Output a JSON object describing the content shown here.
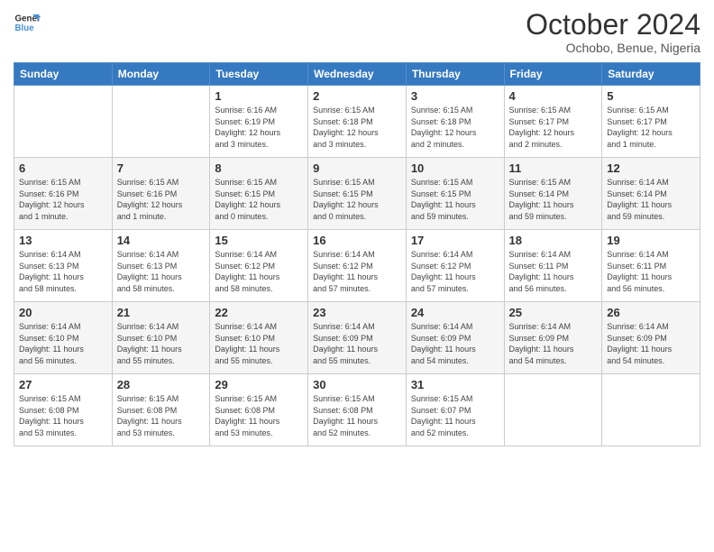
{
  "logo": {
    "line1": "General",
    "line2": "Blue"
  },
  "title": "October 2024",
  "subtitle": "Ochobo, Benue, Nigeria",
  "days_of_week": [
    "Sunday",
    "Monday",
    "Tuesday",
    "Wednesday",
    "Thursday",
    "Friday",
    "Saturday"
  ],
  "weeks": [
    [
      {
        "day": "",
        "info": ""
      },
      {
        "day": "",
        "info": ""
      },
      {
        "day": "1",
        "info": "Sunrise: 6:16 AM\nSunset: 6:19 PM\nDaylight: 12 hours\nand 3 minutes."
      },
      {
        "day": "2",
        "info": "Sunrise: 6:15 AM\nSunset: 6:18 PM\nDaylight: 12 hours\nand 3 minutes."
      },
      {
        "day": "3",
        "info": "Sunrise: 6:15 AM\nSunset: 6:18 PM\nDaylight: 12 hours\nand 2 minutes."
      },
      {
        "day": "4",
        "info": "Sunrise: 6:15 AM\nSunset: 6:17 PM\nDaylight: 12 hours\nand 2 minutes."
      },
      {
        "day": "5",
        "info": "Sunrise: 6:15 AM\nSunset: 6:17 PM\nDaylight: 12 hours\nand 1 minute."
      }
    ],
    [
      {
        "day": "6",
        "info": "Sunrise: 6:15 AM\nSunset: 6:16 PM\nDaylight: 12 hours\nand 1 minute."
      },
      {
        "day": "7",
        "info": "Sunrise: 6:15 AM\nSunset: 6:16 PM\nDaylight: 12 hours\nand 1 minute."
      },
      {
        "day": "8",
        "info": "Sunrise: 6:15 AM\nSunset: 6:15 PM\nDaylight: 12 hours\nand 0 minutes."
      },
      {
        "day": "9",
        "info": "Sunrise: 6:15 AM\nSunset: 6:15 PM\nDaylight: 12 hours\nand 0 minutes."
      },
      {
        "day": "10",
        "info": "Sunrise: 6:15 AM\nSunset: 6:15 PM\nDaylight: 11 hours\nand 59 minutes."
      },
      {
        "day": "11",
        "info": "Sunrise: 6:15 AM\nSunset: 6:14 PM\nDaylight: 11 hours\nand 59 minutes."
      },
      {
        "day": "12",
        "info": "Sunrise: 6:14 AM\nSunset: 6:14 PM\nDaylight: 11 hours\nand 59 minutes."
      }
    ],
    [
      {
        "day": "13",
        "info": "Sunrise: 6:14 AM\nSunset: 6:13 PM\nDaylight: 11 hours\nand 58 minutes."
      },
      {
        "day": "14",
        "info": "Sunrise: 6:14 AM\nSunset: 6:13 PM\nDaylight: 11 hours\nand 58 minutes."
      },
      {
        "day": "15",
        "info": "Sunrise: 6:14 AM\nSunset: 6:12 PM\nDaylight: 11 hours\nand 58 minutes."
      },
      {
        "day": "16",
        "info": "Sunrise: 6:14 AM\nSunset: 6:12 PM\nDaylight: 11 hours\nand 57 minutes."
      },
      {
        "day": "17",
        "info": "Sunrise: 6:14 AM\nSunset: 6:12 PM\nDaylight: 11 hours\nand 57 minutes."
      },
      {
        "day": "18",
        "info": "Sunrise: 6:14 AM\nSunset: 6:11 PM\nDaylight: 11 hours\nand 56 minutes."
      },
      {
        "day": "19",
        "info": "Sunrise: 6:14 AM\nSunset: 6:11 PM\nDaylight: 11 hours\nand 56 minutes."
      }
    ],
    [
      {
        "day": "20",
        "info": "Sunrise: 6:14 AM\nSunset: 6:10 PM\nDaylight: 11 hours\nand 56 minutes."
      },
      {
        "day": "21",
        "info": "Sunrise: 6:14 AM\nSunset: 6:10 PM\nDaylight: 11 hours\nand 55 minutes."
      },
      {
        "day": "22",
        "info": "Sunrise: 6:14 AM\nSunset: 6:10 PM\nDaylight: 11 hours\nand 55 minutes."
      },
      {
        "day": "23",
        "info": "Sunrise: 6:14 AM\nSunset: 6:09 PM\nDaylight: 11 hours\nand 55 minutes."
      },
      {
        "day": "24",
        "info": "Sunrise: 6:14 AM\nSunset: 6:09 PM\nDaylight: 11 hours\nand 54 minutes."
      },
      {
        "day": "25",
        "info": "Sunrise: 6:14 AM\nSunset: 6:09 PM\nDaylight: 11 hours\nand 54 minutes."
      },
      {
        "day": "26",
        "info": "Sunrise: 6:14 AM\nSunset: 6:09 PM\nDaylight: 11 hours\nand 54 minutes."
      }
    ],
    [
      {
        "day": "27",
        "info": "Sunrise: 6:15 AM\nSunset: 6:08 PM\nDaylight: 11 hours\nand 53 minutes."
      },
      {
        "day": "28",
        "info": "Sunrise: 6:15 AM\nSunset: 6:08 PM\nDaylight: 11 hours\nand 53 minutes."
      },
      {
        "day": "29",
        "info": "Sunrise: 6:15 AM\nSunset: 6:08 PM\nDaylight: 11 hours\nand 53 minutes."
      },
      {
        "day": "30",
        "info": "Sunrise: 6:15 AM\nSunset: 6:08 PM\nDaylight: 11 hours\nand 52 minutes."
      },
      {
        "day": "31",
        "info": "Sunrise: 6:15 AM\nSunset: 6:07 PM\nDaylight: 11 hours\nand 52 minutes."
      },
      {
        "day": "",
        "info": ""
      },
      {
        "day": "",
        "info": ""
      }
    ]
  ]
}
